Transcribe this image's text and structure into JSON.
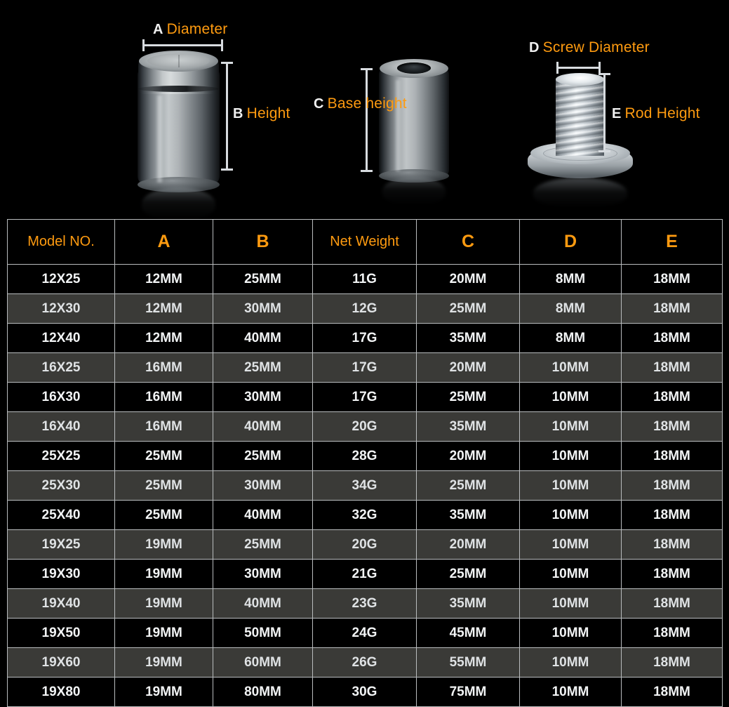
{
  "diagram": {
    "annotations": [
      {
        "letter": "A",
        "text": "Diameter",
        "name": "annotation-diameter"
      },
      {
        "letter": "B",
        "text": "Height",
        "name": "annotation-height"
      },
      {
        "letter": "C",
        "text": "Base height",
        "name": "annotation-base-height"
      },
      {
        "letter": "D",
        "text": "Screw Diameter",
        "name": "annotation-screw-diameter"
      },
      {
        "letter": "E",
        "text": "Rod Height",
        "name": "annotation-rod-height"
      }
    ]
  },
  "colors": {
    "accent": "#ff9b10",
    "background": "#000000",
    "stripe": "#3a3a37",
    "border": "#b9bcbe",
    "text": "#f2f4f5"
  },
  "table": {
    "headers": [
      "Model NO.",
      "A",
      "B",
      "Net Weight",
      "C",
      "D",
      "E"
    ],
    "rows": [
      [
        "12X25",
        "12MM",
        "25MM",
        "11G",
        "20MM",
        "8MM",
        "18MM"
      ],
      [
        "12X30",
        "12MM",
        "30MM",
        "12G",
        "25MM",
        "8MM",
        "18MM"
      ],
      [
        "12X40",
        "12MM",
        "40MM",
        "17G",
        "35MM",
        "8MM",
        "18MM"
      ],
      [
        "16X25",
        "16MM",
        "25MM",
        "17G",
        "20MM",
        "10MM",
        "18MM"
      ],
      [
        "16X30",
        "16MM",
        "30MM",
        "17G",
        "25MM",
        "10MM",
        "18MM"
      ],
      [
        "16X40",
        "16MM",
        "40MM",
        "20G",
        "35MM",
        "10MM",
        "18MM"
      ],
      [
        "25X25",
        "25MM",
        "25MM",
        "28G",
        "20MM",
        "10MM",
        "18MM"
      ],
      [
        "25X30",
        "25MM",
        "30MM",
        "34G",
        "25MM",
        "10MM",
        "18MM"
      ],
      [
        "25X40",
        "25MM",
        "40MM",
        "32G",
        "35MM",
        "10MM",
        "18MM"
      ],
      [
        "19X25",
        "19MM",
        "25MM",
        "20G",
        "20MM",
        "10MM",
        "18MM"
      ],
      [
        "19X30",
        "19MM",
        "30MM",
        "21G",
        "25MM",
        "10MM",
        "18MM"
      ],
      [
        "19X40",
        "19MM",
        "40MM",
        "23G",
        "35MM",
        "10MM",
        "18MM"
      ],
      [
        "19X50",
        "19MM",
        "50MM",
        "24G",
        "45MM",
        "10MM",
        "18MM"
      ],
      [
        "19X60",
        "19MM",
        "60MM",
        "26G",
        "55MM",
        "10MM",
        "18MM"
      ],
      [
        "19X80",
        "19MM",
        "80MM",
        "30G",
        "75MM",
        "10MM",
        "18MM"
      ]
    ],
    "striped_row_indexes": [
      1,
      3,
      5,
      7,
      9,
      11,
      13
    ]
  }
}
